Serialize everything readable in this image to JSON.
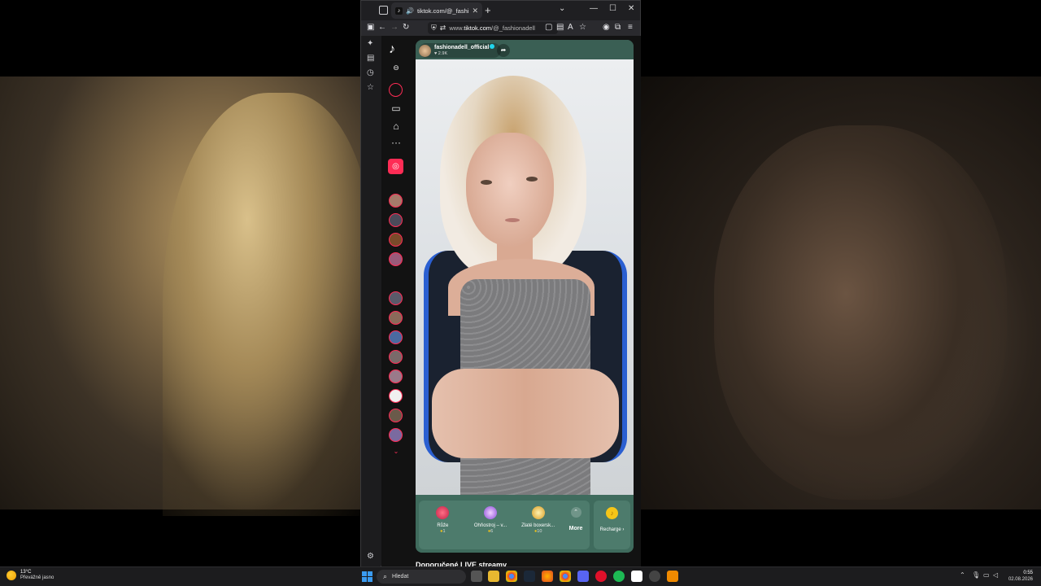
{
  "browser": {
    "tab_title": "tiktok.com/@_fashionadell",
    "tab_close": "✕",
    "new_tab": "+",
    "url_prefix": "www.",
    "url_domain": "tiktok.com",
    "url_path": "/@_fashionadell",
    "window_controls": [
      "⌄",
      "—",
      "☐",
      "✕"
    ]
  },
  "stream": {
    "host_name": "fashionadell_official",
    "viewer_count": "2.9K",
    "recommended_title": "Doporučené LIVE streamy"
  },
  "gifts": [
    {
      "label": "Růže",
      "price": "1",
      "color": "#e8435e"
    },
    {
      "label": "Ohňostroj – v...",
      "price": "6",
      "color": "#9b63e0"
    },
    {
      "label": "Zlaté boxersk...",
      "price": "10",
      "color": "#f0c040"
    }
  ],
  "more_label": "More",
  "recharge_label": "Recharge ›",
  "taskbar": {
    "weather_temp": "13°C",
    "weather_desc": "Převážně jasno",
    "search_label": "Hledat",
    "time": "0:55",
    "date": "02.08.2026"
  },
  "colors": {
    "accent": "#fe2c55",
    "player_bg": "#3f6b5d",
    "coin": "#f5c518"
  }
}
